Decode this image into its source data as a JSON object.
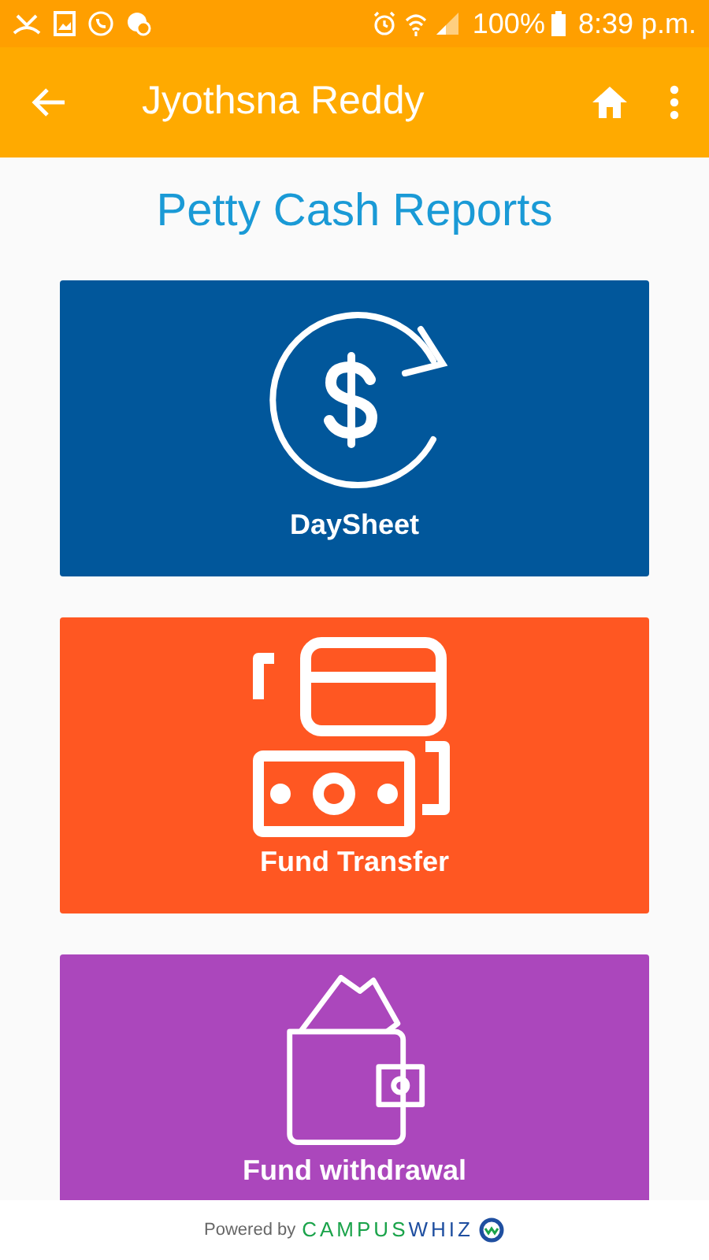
{
  "status_bar": {
    "battery": "100%",
    "time": "8:39 p.m."
  },
  "app_bar": {
    "title": "Jyothsna Reddy"
  },
  "heading": "Petty Cash Reports",
  "cards": [
    {
      "kind": "daysheet",
      "label": "DaySheet",
      "color": "#01579b"
    },
    {
      "kind": "transfer",
      "label": "Fund Transfer",
      "color": "#ff5722"
    },
    {
      "kind": "wallet",
      "label": "Fund withdrawal",
      "color": "#ab47bc"
    }
  ],
  "footer": {
    "powered_by": "Powered by",
    "brand_left": "CAMPUS",
    "brand_right": "WHIZ"
  }
}
